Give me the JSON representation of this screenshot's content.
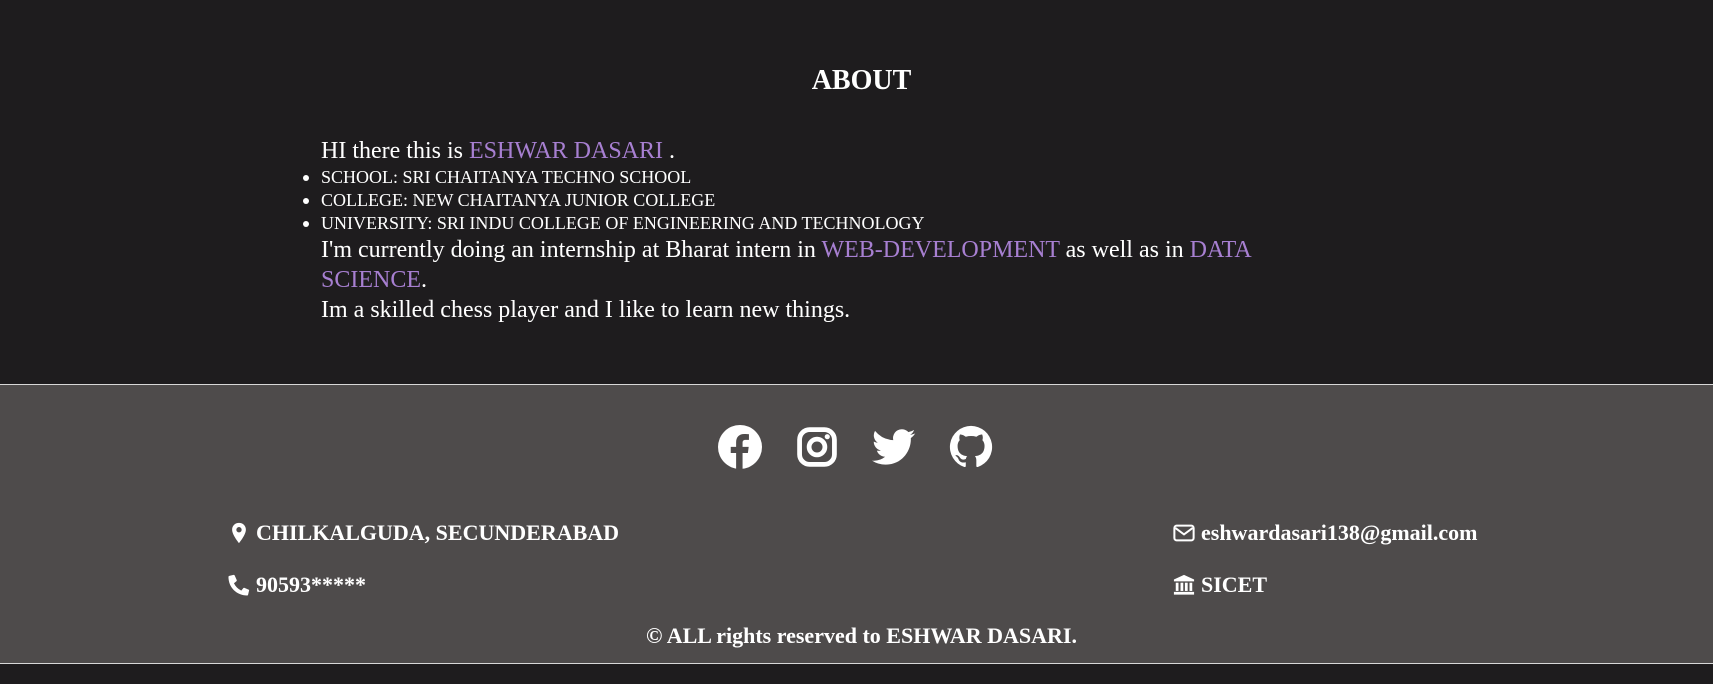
{
  "about": {
    "title": "ABOUT",
    "intro_prefix": "HI there this is ",
    "intro_name": "ESHWAR DASARI",
    "intro_suffix": " .",
    "facts": [
      "SCHOOL: SRI CHAITANYA TECHNO SCHOOL",
      "COLLEGE: NEW CHAITANYA JUNIOR COLLEGE",
      "UNIVERSITY: SRI INDU COLLEGE OF ENGINEERING AND TECHNOLOGY"
    ],
    "internship_prefix": "I'm currently doing an internship at Bharat intern in ",
    "internship_field1": "WEB-DEVELOPMENT",
    "internship_middle": " as well as in ",
    "internship_field2": "DATA SCIENCE",
    "internship_suffix": ".",
    "hobby": "Im a skilled chess player and I like to learn new things.",
    "highlight_color": "#a77fd1"
  },
  "footer": {
    "socials": [
      {
        "icon": "facebook-icon"
      },
      {
        "icon": "instagram-icon"
      },
      {
        "icon": "twitter-icon"
      },
      {
        "icon": "github-icon"
      }
    ],
    "location": "CHILKALGUDA, SECUNDERABAD",
    "phone": "90593*****",
    "email": "eshwardasari138@gmail.com",
    "institution": "SICET",
    "copyright": "© ALL rights reserved to ESHWAR DASARI."
  }
}
